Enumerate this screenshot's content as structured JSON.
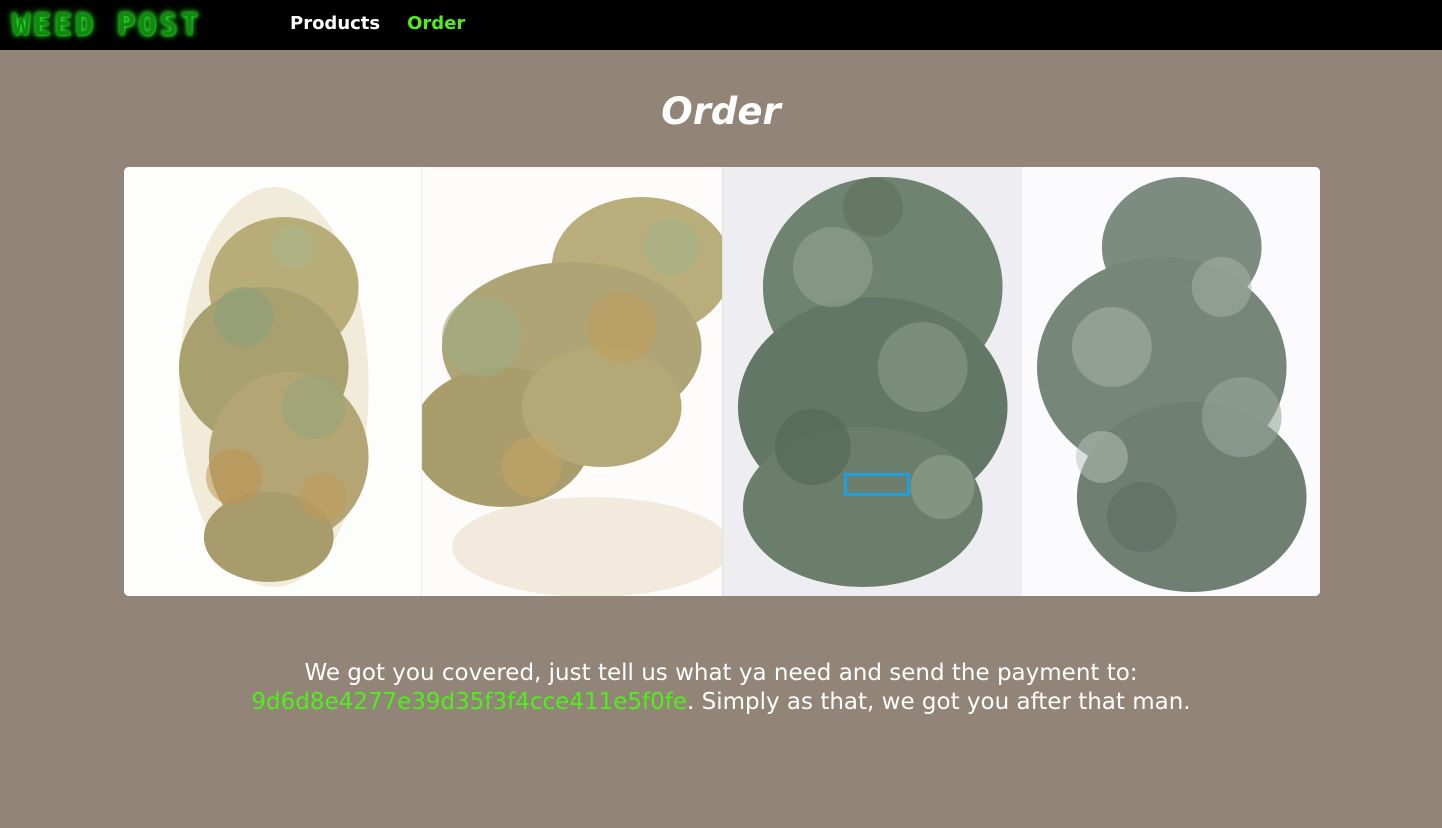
{
  "header": {
    "logo_text": "WEED POST",
    "nav": [
      {
        "label": "Products",
        "active": false
      },
      {
        "label": "Order",
        "active": true
      }
    ]
  },
  "main": {
    "title": "Order",
    "message": {
      "line1": "We got you covered, just tell us what ya need and send the payment to:",
      "address": "9d6d8e4277e39d35f3f4cce411e5f0fe",
      "line2_rest": ". Simply as that, we got you after that man."
    }
  },
  "colors": {
    "page_background": "#928577",
    "nav_background": "#000000",
    "accent_green": "#4fef1a",
    "focus_highlight": "#1ea0dc"
  }
}
